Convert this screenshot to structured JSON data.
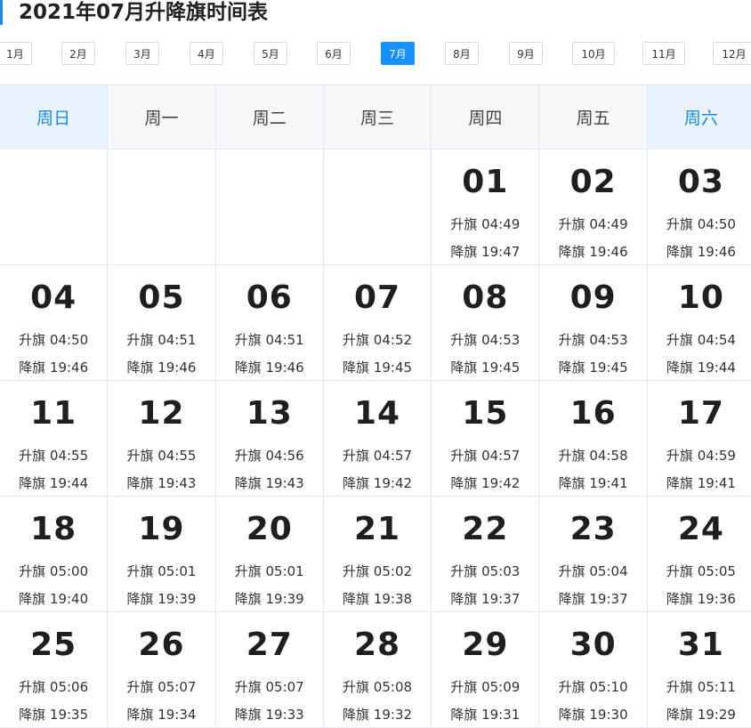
{
  "page": {
    "title": "2021年07月升降旗时间表"
  },
  "months": [
    "1月",
    "2月",
    "3月",
    "4月",
    "5月",
    "6月",
    "7月",
    "8月",
    "9月",
    "10月",
    "11月",
    "12月"
  ],
  "active_month_index": 6,
  "weekdays": [
    "周日",
    "周一",
    "周二",
    "周三",
    "周四",
    "周五",
    "周六"
  ],
  "weeks": [
    [
      null,
      null,
      null,
      null,
      {
        "day": "01",
        "rise": "升旗 04:49",
        "lower": "降旗 19:47"
      },
      {
        "day": "02",
        "rise": "升旗 04:49",
        "lower": "降旗 19:46"
      },
      {
        "day": "03",
        "rise": "升旗 04:50",
        "lower": "降旗 19:46"
      }
    ],
    [
      {
        "day": "04",
        "rise": "升旗 04:50",
        "lower": "降旗 19:46"
      },
      {
        "day": "05",
        "rise": "升旗 04:51",
        "lower": "降旗 19:46"
      },
      {
        "day": "06",
        "rise": "升旗 04:51",
        "lower": "降旗 19:46"
      },
      {
        "day": "07",
        "rise": "升旗 04:52",
        "lower": "降旗 19:45"
      },
      {
        "day": "08",
        "rise": "升旗 04:53",
        "lower": "降旗 19:45"
      },
      {
        "day": "09",
        "rise": "升旗 04:53",
        "lower": "降旗 19:45"
      },
      {
        "day": "10",
        "rise": "升旗 04:54",
        "lower": "降旗 19:44"
      }
    ],
    [
      {
        "day": "11",
        "rise": "升旗 04:55",
        "lower": "降旗 19:44"
      },
      {
        "day": "12",
        "rise": "升旗 04:55",
        "lower": "降旗 19:43"
      },
      {
        "day": "13",
        "rise": "升旗 04:56",
        "lower": "降旗 19:43"
      },
      {
        "day": "14",
        "rise": "升旗 04:57",
        "lower": "降旗 19:42"
      },
      {
        "day": "15",
        "rise": "升旗 04:57",
        "lower": "降旗 19:42"
      },
      {
        "day": "16",
        "rise": "升旗 04:58",
        "lower": "降旗 19:41"
      },
      {
        "day": "17",
        "rise": "升旗 04:59",
        "lower": "降旗 19:41"
      }
    ],
    [
      {
        "day": "18",
        "rise": "升旗 05:00",
        "lower": "降旗 19:40"
      },
      {
        "day": "19",
        "rise": "升旗 05:01",
        "lower": "降旗 19:39"
      },
      {
        "day": "20",
        "rise": "升旗 05:01",
        "lower": "降旗 19:39"
      },
      {
        "day": "21",
        "rise": "升旗 05:02",
        "lower": "降旗 19:38"
      },
      {
        "day": "22",
        "rise": "升旗 05:03",
        "lower": "降旗 19:37"
      },
      {
        "day": "23",
        "rise": "升旗 05:04",
        "lower": "降旗 19:37"
      },
      {
        "day": "24",
        "rise": "升旗 05:05",
        "lower": "降旗 19:36"
      }
    ],
    [
      {
        "day": "25",
        "rise": "升旗 05:06",
        "lower": "降旗 19:35"
      },
      {
        "day": "26",
        "rise": "升旗 05:07",
        "lower": "降旗 19:34"
      },
      {
        "day": "27",
        "rise": "升旗 05:07",
        "lower": "降旗 19:33"
      },
      {
        "day": "28",
        "rise": "升旗 05:08",
        "lower": "降旗 19:32"
      },
      {
        "day": "29",
        "rise": "升旗 05:09",
        "lower": "降旗 19:31"
      },
      {
        "day": "30",
        "rise": "升旗 05:10",
        "lower": "降旗 19:30"
      },
      {
        "day": "31",
        "rise": "升旗 05:11",
        "lower": "降旗 19:29"
      }
    ]
  ],
  "colors": {
    "accent": "#1890ff",
    "weekend_text": "#1e88e5",
    "weekend_bg": "#e8f3fe",
    "header_bg": "#f5f7fa"
  }
}
